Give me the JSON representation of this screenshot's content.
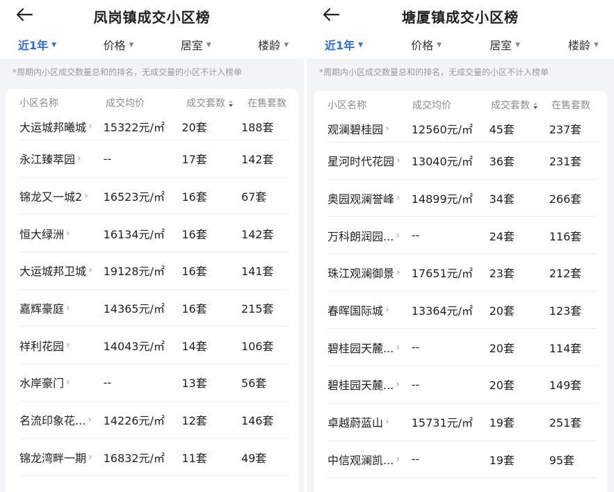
{
  "icons": {
    "back": "arrow-left-icon",
    "chevron": "chevron-right-icon",
    "caret": "caret-down-icon",
    "sort": "sort-icon"
  },
  "accent_color": "#2b6ff0",
  "left": {
    "title": "凤岗镇成交小区榜",
    "filters": [
      "近1年",
      "价格",
      "居室",
      "楼龄"
    ],
    "active_filter": "近1年",
    "note": "*周期内小区成交数量总和的排名，无成交量的小区不计入榜单",
    "columns": [
      "小区名称",
      "成交均价",
      "成交套数",
      "在售套数"
    ],
    "rows": [
      {
        "name": "大运城邦曦城",
        "price": "15322元/㎡",
        "deals": "20套",
        "onsale": "188套"
      },
      {
        "name": "永江臻萃园",
        "price": "--",
        "deals": "17套",
        "onsale": "142套"
      },
      {
        "name": "锦龙又一城2",
        "price": "16523元/㎡",
        "deals": "16套",
        "onsale": "67套"
      },
      {
        "name": "恒大绿洲",
        "price": "16134元/㎡",
        "deals": "16套",
        "onsale": "142套"
      },
      {
        "name": "大运城邦卫城",
        "price": "19128元/㎡",
        "deals": "16套",
        "onsale": "141套"
      },
      {
        "name": "嘉辉豪庭",
        "price": "14365元/㎡",
        "deals": "16套",
        "onsale": "215套"
      },
      {
        "name": "祥利花园",
        "price": "14043元/㎡",
        "deals": "14套",
        "onsale": "106套"
      },
      {
        "name": "水岸豪门",
        "price": "--",
        "deals": "13套",
        "onsale": "56套"
      },
      {
        "name": "名流印象花...",
        "price": "14226元/㎡",
        "deals": "12套",
        "onsale": "146套"
      },
      {
        "name": "锦龙湾畔一期",
        "price": "16832元/㎡",
        "deals": "11套",
        "onsale": "49套"
      }
    ]
  },
  "right": {
    "title": "塘厦镇成交小区榜",
    "filters": [
      "近1年",
      "价格",
      "居室",
      "楼龄"
    ],
    "active_filter": "近1年",
    "note": "*周期内小区成交数量总和的排名，无成交量的小区不计入榜单",
    "columns": [
      "小区名称",
      "成交均价",
      "成交套数",
      "在售套数"
    ],
    "rows": [
      {
        "name": "观澜碧桂园",
        "price": "12560元/㎡",
        "deals": "45套",
        "onsale": "237套"
      },
      {
        "name": "星河时代花园",
        "price": "13040元/㎡",
        "deals": "36套",
        "onsale": "231套"
      },
      {
        "name": "奥园观澜誉峰",
        "price": "14899元/㎡",
        "deals": "34套",
        "onsale": "266套"
      },
      {
        "name": "万科朗润园...",
        "price": "--",
        "deals": "24套",
        "onsale": "116套"
      },
      {
        "name": "珠江观澜御景",
        "price": "17651元/㎡",
        "deals": "23套",
        "onsale": "212套"
      },
      {
        "name": "春晖国际城",
        "price": "13364元/㎡",
        "deals": "20套",
        "onsale": "123套"
      },
      {
        "name": "碧桂园天麓...",
        "price": "--",
        "deals": "20套",
        "onsale": "114套"
      },
      {
        "name": "碧桂园天麓...",
        "price": "--",
        "deals": "20套",
        "onsale": "149套"
      },
      {
        "name": "卓越蔚蓝山",
        "price": "15731元/㎡",
        "deals": "19套",
        "onsale": "251套"
      },
      {
        "name": "中信观澜凯...",
        "price": "--",
        "deals": "19套",
        "onsale": "95套"
      }
    ]
  }
}
